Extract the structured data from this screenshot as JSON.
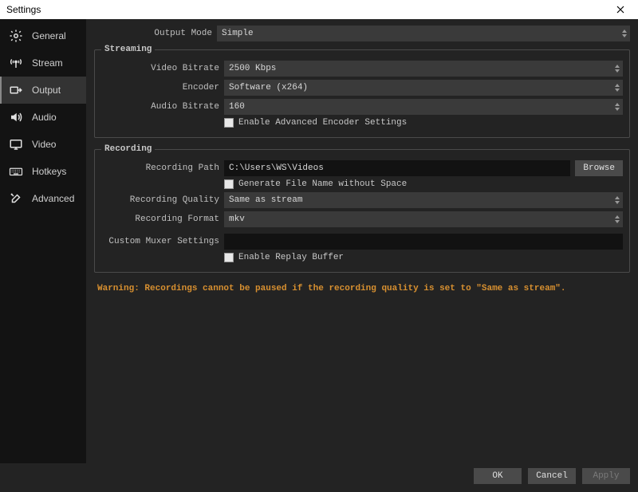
{
  "window": {
    "title": "Settings"
  },
  "sidebar": {
    "items": [
      {
        "label": "General"
      },
      {
        "label": "Stream"
      },
      {
        "label": "Output"
      },
      {
        "label": "Audio"
      },
      {
        "label": "Video"
      },
      {
        "label": "Hotkeys"
      },
      {
        "label": "Advanced"
      }
    ]
  },
  "top": {
    "output_mode_label": "Output Mode",
    "output_mode_value": "Simple"
  },
  "streaming": {
    "legend": "Streaming",
    "video_bitrate_label": "Video Bitrate",
    "video_bitrate_value": "2500 Kbps",
    "encoder_label": "Encoder",
    "encoder_value": "Software (x264)",
    "audio_bitrate_label": "Audio Bitrate",
    "audio_bitrate_value": "160",
    "enable_advanced_label": "Enable Advanced Encoder Settings"
  },
  "recording": {
    "legend": "Recording",
    "path_label": "Recording Path",
    "path_value": "C:\\Users\\WS\\Videos",
    "browse_label": "Browse",
    "gen_filename_label": "Generate File Name without Space",
    "quality_label": "Recording Quality",
    "quality_value": "Same as stream",
    "format_label": "Recording Format",
    "format_value": "mkv",
    "muxer_label": "Custom Muxer Settings",
    "muxer_value": "",
    "replay_buffer_label": "Enable Replay Buffer"
  },
  "warning_text": "Warning: Recordings cannot be paused if the recording quality is set to \"Same as stream\".",
  "footer": {
    "ok": "OK",
    "cancel": "Cancel",
    "apply": "Apply"
  }
}
